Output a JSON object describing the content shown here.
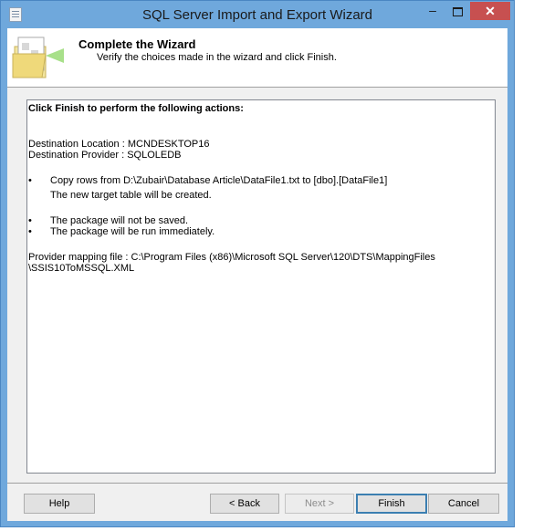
{
  "window": {
    "title": "SQL Server Import and Export Wizard",
    "minimize_label": "–",
    "close_label": "✕"
  },
  "header": {
    "title": "Complete the Wizard",
    "subtitle": "Verify the choices made in the wizard and click Finish."
  },
  "content": {
    "title": "Click Finish to perform the following actions:",
    "destination_location": "Destination Location : MCNDESKTOP16",
    "destination_provider": "Destination Provider : SQLOLEDB",
    "bullet_symbol": "•",
    "copy_rows": "Copy rows from D:\\Zubair\\Database Article\\DataFile1.txt to [dbo].[DataFile1]",
    "new_table": "The new target table will be created.",
    "not_saved": "The package will not be saved.",
    "run_immediately": "The package will be run immediately.",
    "mapping_line1": "Provider mapping file : C:\\Program Files (x86)\\Microsoft SQL Server\\120\\DTS\\MappingFiles",
    "mapping_line2": "\\SSIS10ToMSSQL.XML"
  },
  "buttons": {
    "help": "Help",
    "back": "< Back",
    "next": "Next >",
    "finish": "Finish",
    "cancel": "Cancel"
  }
}
